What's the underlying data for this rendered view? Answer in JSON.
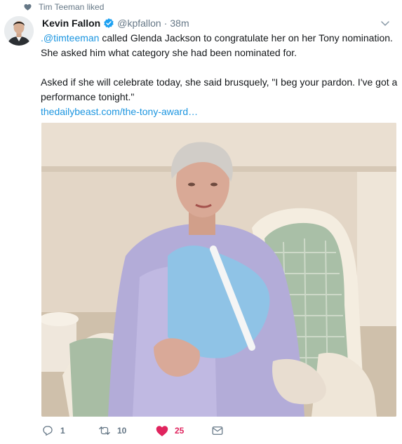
{
  "social_context": {
    "text": "Tim Teeman liked"
  },
  "tweet": {
    "author_name": "Kevin Fallon",
    "handle": "@kpfallon",
    "separator": "·",
    "time": "38m",
    "mention": ".@timteeman",
    "text_line1_rest": " called Glenda Jackson to congratulate her on her Tony nomination. She asked him what category she had been nominated for.",
    "text_para2": "Asked if she will celebrate today, she said brusquely, \"I beg your pardon. I've got a performance tonight.\"",
    "link": "thedailybeast.com/the-tony-award…"
  },
  "actions": {
    "reply_count": "1",
    "retweet_count": "10",
    "like_count": "25"
  },
  "colors": {
    "link": "#1b95e0",
    "like_active": "#e0245e",
    "muted": "#657786",
    "verified": "#1da1f2"
  },
  "icons": [
    "heart-icon",
    "verified-badge-icon",
    "chevron-down-icon",
    "reply-icon",
    "retweet-icon",
    "like-icon",
    "direct-message-icon"
  ]
}
